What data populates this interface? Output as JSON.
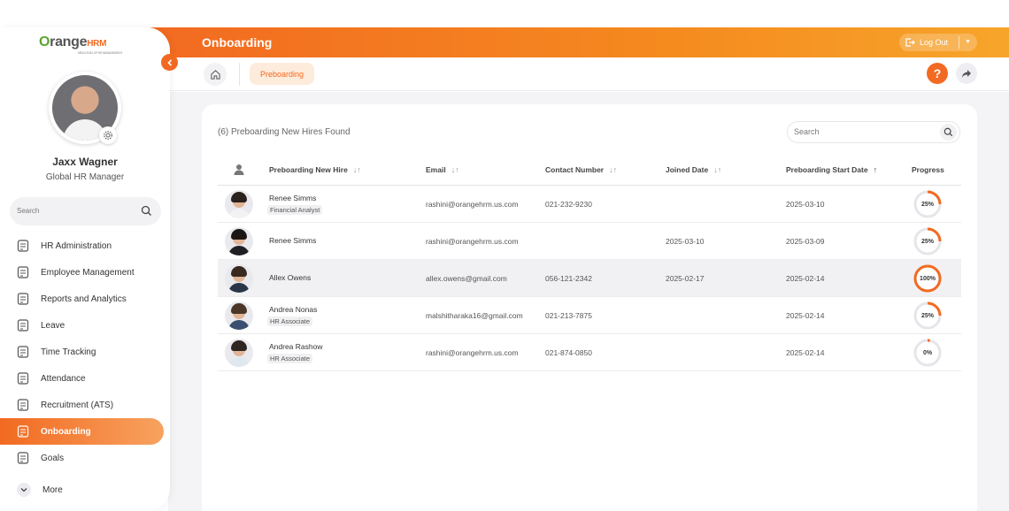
{
  "app": {
    "logo_orange": "range",
    "logo_hrm": "HRM",
    "logo_tagline": "NEW LEVEL OF HR MANAGEMENT",
    "page_title": "Onboarding",
    "logout_label": "Log Out",
    "accent_color": "#f26a21"
  },
  "breadcrumb": {
    "current": "Preboarding"
  },
  "help_label": "?",
  "user": {
    "name": "Jaxx Wagner",
    "role": "Global HR Manager"
  },
  "sidebar": {
    "search_placeholder": "Search",
    "items": [
      {
        "label": "HR Administration",
        "icon": "hr-admin-icon"
      },
      {
        "label": "Employee Management",
        "icon": "employee-management-icon"
      },
      {
        "label": "Reports and Analytics",
        "icon": "reports-icon"
      },
      {
        "label": "Leave",
        "icon": "leave-icon"
      },
      {
        "label": "Time Tracking",
        "icon": "time-tracking-icon"
      },
      {
        "label": "Attendance",
        "icon": "attendance-icon"
      },
      {
        "label": "Recruitment (ATS)",
        "icon": "recruitment-icon"
      },
      {
        "label": "Onboarding",
        "icon": "onboarding-icon",
        "active": true
      },
      {
        "label": "Goals",
        "icon": "goals-icon"
      }
    ],
    "more_label": "More"
  },
  "table": {
    "count_label": "(6) Preboarding New Hires Found",
    "search_placeholder": "Search",
    "columns": [
      "Preboarding New Hire",
      "Email",
      "Contact Number",
      "Joined Date",
      "Preboarding Start Date",
      "Progress"
    ],
    "rows": [
      {
        "name": "Renee Simms",
        "title": "Financial Analyst",
        "email": "rashini@orangehrm.us.com",
        "contact": "021-232-9230",
        "joined": "",
        "start": "2025-03-10",
        "progress": 25,
        "progress_label": "25%"
      },
      {
        "name": "Renee Simms",
        "title": "",
        "email": "rashini@orangehrm.us.com",
        "contact": "",
        "joined": "2025-03-10",
        "start": "2025-03-09",
        "progress": 25,
        "progress_label": "25%"
      },
      {
        "name": "Allex Owens",
        "title": "",
        "email": "allex.owens@gmail.com",
        "contact": "056-121-2342",
        "joined": "2025-02-17",
        "start": "2025-02-14",
        "progress": 100,
        "progress_label": "100%"
      },
      {
        "name": "Andrea Nonas",
        "title": "HR Associate",
        "email": "malshitharaka16@gmail.com",
        "contact": "021-213-7875",
        "joined": "",
        "start": "2025-02-14",
        "progress": 25,
        "progress_label": "25%"
      },
      {
        "name": "Andrea Rashow",
        "title": "HR Associate",
        "email": "rashini@orangehrm.us.com",
        "contact": "021-874-0850",
        "joined": "",
        "start": "2025-02-14",
        "progress": 0,
        "progress_label": "0%"
      }
    ]
  }
}
